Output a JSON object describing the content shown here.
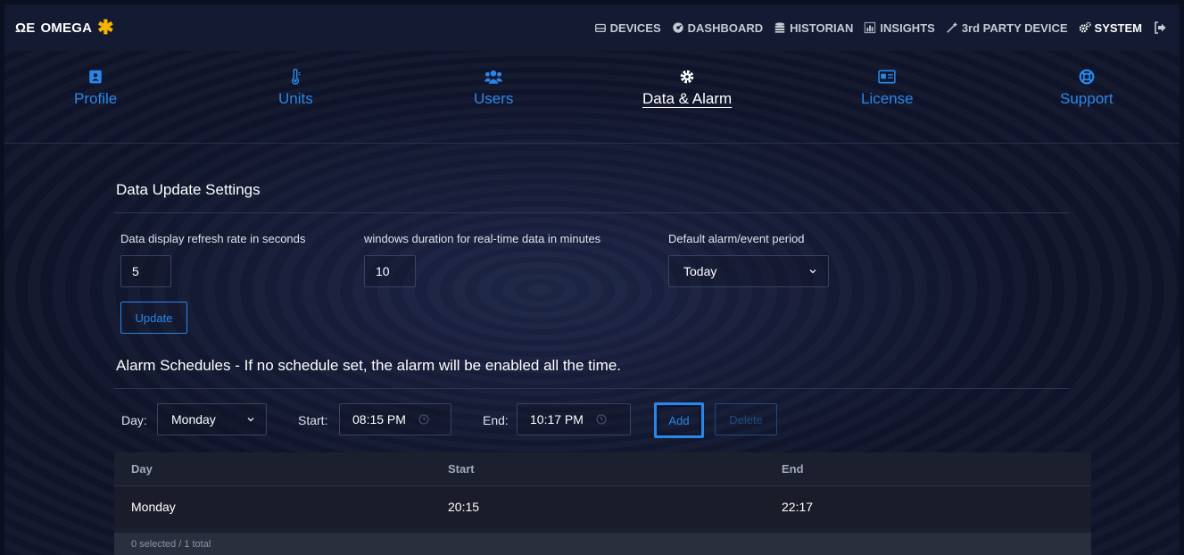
{
  "brand": {
    "name": "OMEGA",
    "mark": "ΩΕ",
    "star": "✱"
  },
  "topnav": {
    "items": [
      {
        "label": "DEVICES",
        "icon": "devices-icon"
      },
      {
        "label": "DASHBOARD",
        "icon": "dashboard-icon"
      },
      {
        "label": "HISTORIAN",
        "icon": "database-icon"
      },
      {
        "label": "INSIGHTS",
        "icon": "chart-icon"
      },
      {
        "label": "3rd PARTY DEVICE",
        "icon": "wand-icon"
      },
      {
        "label": "SYSTEM",
        "icon": "gears-icon"
      }
    ],
    "active": "SYSTEM"
  },
  "tabs": [
    {
      "label": "Profile",
      "icon": "id-badge-icon"
    },
    {
      "label": "Units",
      "icon": "thermometer-icon"
    },
    {
      "label": "Users",
      "icon": "users-icon"
    },
    {
      "label": "Data & Alarm",
      "icon": "gear-icon"
    },
    {
      "label": "License",
      "icon": "id-card-icon"
    },
    {
      "label": "Support",
      "icon": "life-ring-icon"
    }
  ],
  "active_tab": "Data & Alarm",
  "data_update": {
    "title": "Data Update Settings",
    "refresh_label": "Data display refresh rate in seconds",
    "refresh_value": "5",
    "window_label": "windows duration for real-time data in minutes",
    "window_value": "10",
    "alarm_period_label": "Default alarm/event period",
    "alarm_period_value": "Today",
    "update_button": "Update"
  },
  "alarm": {
    "title": "Alarm Schedules - If no schedule set, the alarm will be enabled all the time.",
    "day_label": "Day:",
    "day_value": "Monday",
    "start_label": "Start:",
    "start_value": "08:15 PM",
    "end_label": "End:",
    "end_value": "10:17 PM",
    "add_button": "Add",
    "delete_button": "Delete"
  },
  "table": {
    "columns": [
      "Day",
      "Start",
      "End"
    ],
    "rows": [
      {
        "day": "Monday",
        "start": "20:15",
        "end": "22:17"
      }
    ],
    "footer": "0 selected / 1 total"
  },
  "colors": {
    "accent": "#2a86e8",
    "brand_star": "#f5b400",
    "nav_bg": "#131a31"
  }
}
